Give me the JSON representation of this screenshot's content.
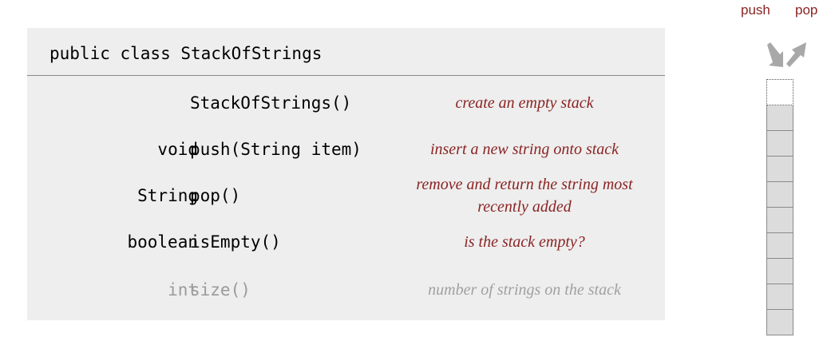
{
  "header": {
    "class_declaration": "public class StackOfStrings"
  },
  "operations": {
    "push_label": "push",
    "pop_label": "pop"
  },
  "api_rows": [
    {
      "return_type": "",
      "signature": "StackOfStrings()",
      "description": "create an empty stack"
    },
    {
      "return_type": "void",
      "signature": "push(String item)",
      "description": "insert a new string onto stack"
    },
    {
      "return_type": "String",
      "signature": "pop()",
      "description": "remove and return the string most recently added"
    },
    {
      "return_type": "boolean",
      "signature": "isEmpty()",
      "description": "is the stack empty?"
    },
    {
      "return_type": "int",
      "signature": "size()",
      "description": "number of strings on the stack"
    }
  ],
  "stack_diagram": {
    "empty_top_slots": 1,
    "filled_slots": 9
  },
  "colors": {
    "description_text": "#8b2323",
    "dimmed_text": "#9a9a9a",
    "panel_background": "#eeeeee",
    "stack_cell_fill": "#dcdcdc",
    "arrow_fill": "#a8a8a8"
  }
}
